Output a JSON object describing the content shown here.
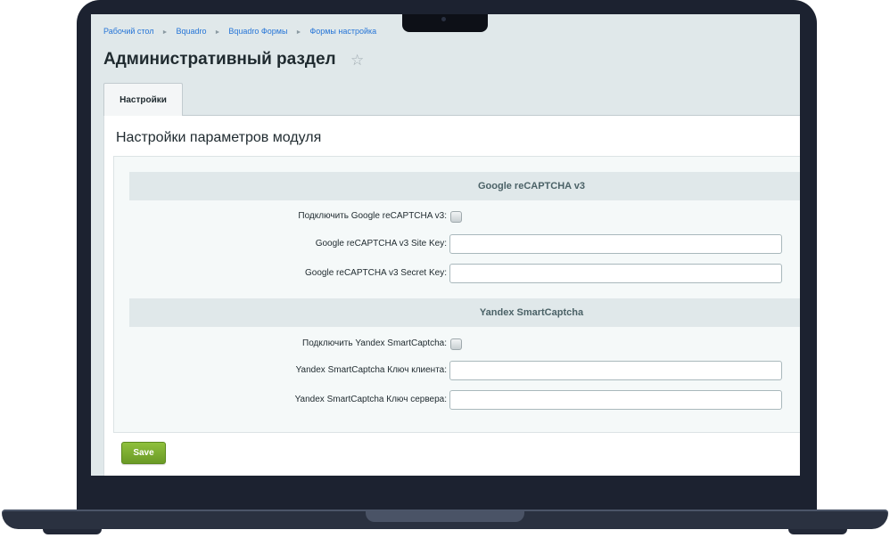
{
  "breadcrumb": {
    "items": [
      "Рабочий стол",
      "Bquadro",
      "Bquadro Формы",
      "Формы настройка"
    ]
  },
  "page": {
    "title": "Административный раздел",
    "favorite_icon": "star-icon"
  },
  "tabs": [
    {
      "label": "Настройки",
      "active": true
    }
  ],
  "main": {
    "section_title": "Настройки параметров модуля",
    "google": {
      "heading": "Google reCAPTCHA v3",
      "enable_label": "Подключить Google reCAPTCHA v3:",
      "enable_checked": false,
      "site_key_label": "Google reCAPTCHA v3 Site Key:",
      "site_key_value": "",
      "secret_key_label": "Google reCAPTCHA v3 Secret Key:",
      "secret_key_value": ""
    },
    "yandex": {
      "heading": "Yandex SmartCaptcha",
      "enable_label": "Подключить Yandex SmartCaptcha:",
      "enable_checked": false,
      "client_key_label": "Yandex SmartCaptcha Ключ клиента:",
      "client_key_value": "",
      "server_key_label": "Yandex SmartCaptcha Ключ сервера:",
      "server_key_value": ""
    },
    "save_label": "Save"
  },
  "colors": {
    "link": "#2675d7",
    "save_button": "#7aad2f",
    "section_heading_bg": "#e0e8ea"
  }
}
